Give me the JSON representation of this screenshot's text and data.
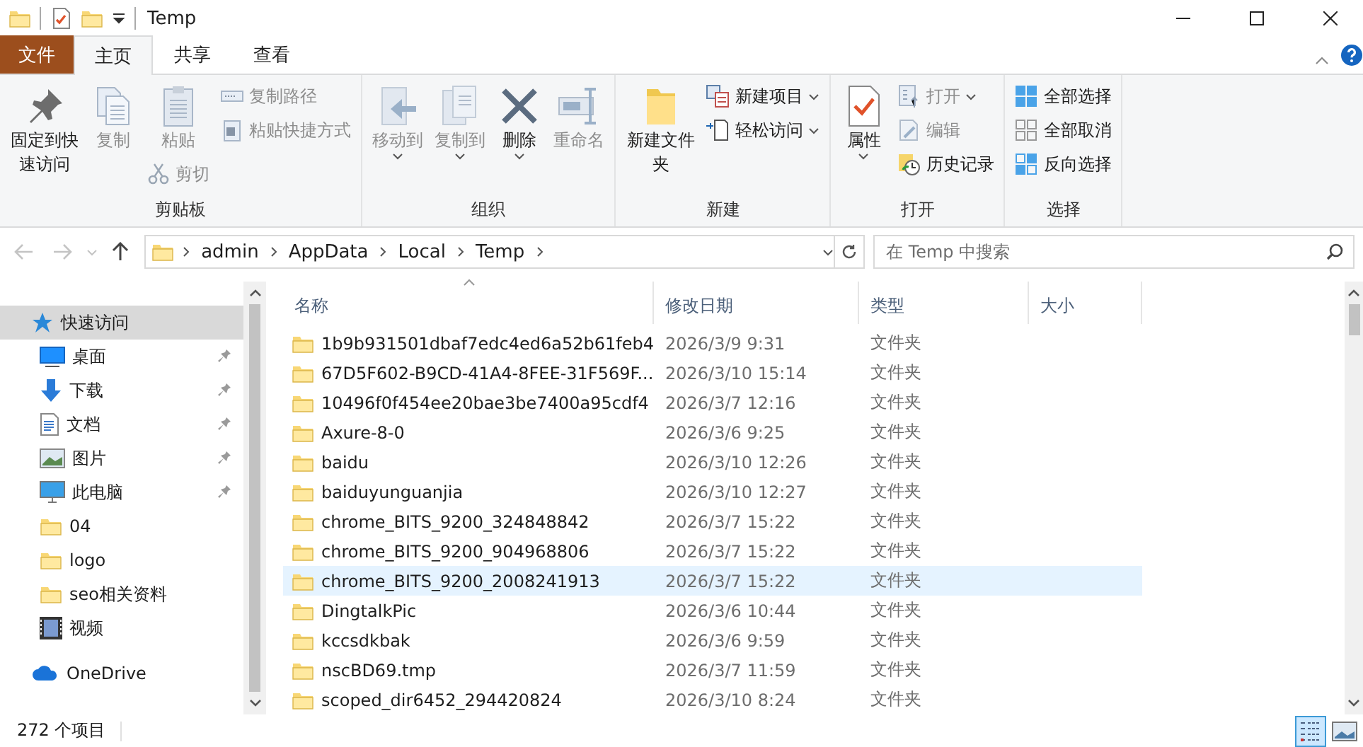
{
  "window": {
    "title": "Temp"
  },
  "ribbon_tabs": [
    {
      "label": "文件",
      "kind": "file",
      "selected": false
    },
    {
      "label": "主页",
      "kind": "tab",
      "selected": true
    },
    {
      "label": "共享",
      "kind": "tab",
      "selected": false
    },
    {
      "label": "查看",
      "kind": "tab",
      "selected": false
    }
  ],
  "ribbon_groups": [
    {
      "label": "剪贴板",
      "columns": [
        [
          {
            "label": "固定到快速访问",
            "kind": "large",
            "disabled": false,
            "menu": false
          }
        ],
        [
          {
            "label": "复制",
            "kind": "large",
            "disabled": true,
            "menu": false
          }
        ],
        [
          {
            "label": "粘贴",
            "kind": "large",
            "disabled": true,
            "menu": false
          },
          {
            "label": "剪切",
            "kind": "small",
            "disabled": true,
            "menu": false
          }
        ],
        [
          {
            "label": "复制路径",
            "kind": "small",
            "disabled": true,
            "menu": false
          },
          {
            "label": "粘贴快捷方式",
            "kind": "small",
            "disabled": true,
            "menu": false
          }
        ]
      ]
    },
    {
      "label": "组织",
      "columns": [
        [
          {
            "label": "移动到",
            "kind": "large",
            "disabled": true,
            "menu": true
          }
        ],
        [
          {
            "label": "复制到",
            "kind": "large",
            "disabled": true,
            "menu": true
          }
        ],
        [
          {
            "label": "删除",
            "kind": "large",
            "disabled": false,
            "menu": true
          }
        ],
        [
          {
            "label": "重命名",
            "kind": "large",
            "disabled": true,
            "menu": false
          }
        ]
      ]
    },
    {
      "label": "新建",
      "columns": [
        [
          {
            "label": "新建文件夹",
            "kind": "large",
            "disabled": false,
            "menu": false
          }
        ],
        [
          {
            "label": "新建项目",
            "kind": "small",
            "disabled": false,
            "menu": true
          },
          {
            "label": "轻松访问",
            "kind": "small",
            "disabled": false,
            "menu": true
          }
        ]
      ]
    },
    {
      "label": "打开",
      "columns": [
        [
          {
            "label": "属性",
            "kind": "large",
            "disabled": false,
            "menu": true
          }
        ],
        [
          {
            "label": "打开",
            "kind": "small",
            "disabled": true,
            "menu": true
          },
          {
            "label": "编辑",
            "kind": "small",
            "disabled": true,
            "menu": false
          },
          {
            "label": "历史记录",
            "kind": "small",
            "disabled": false,
            "menu": false
          }
        ]
      ]
    },
    {
      "label": "选择",
      "columns": [
        [
          {
            "label": "全部选择",
            "kind": "small",
            "disabled": false,
            "menu": false
          },
          {
            "label": "全部取消",
            "kind": "small",
            "disabled": false,
            "menu": false
          },
          {
            "label": "反向选择",
            "kind": "small",
            "disabled": false,
            "menu": false
          }
        ]
      ]
    }
  ],
  "address_bar": {
    "path": [
      "admin",
      "AppData",
      "Local",
      "Temp"
    ]
  },
  "search": {
    "placeholder": "在 Temp 中搜索"
  },
  "sidebar": {
    "items": [
      {
        "label": "快速访问",
        "selected": true,
        "pinned": false,
        "children": [
          {
            "label": "桌面",
            "selected": false,
            "pinned": true
          },
          {
            "label": "下载",
            "selected": false,
            "pinned": true
          },
          {
            "label": "文档",
            "selected": false,
            "pinned": true
          },
          {
            "label": "图片",
            "selected": false,
            "pinned": true
          },
          {
            "label": "此电脑",
            "selected": false,
            "pinned": true
          },
          {
            "label": "04",
            "selected": false,
            "pinned": false
          },
          {
            "label": "logo",
            "selected": false,
            "pinned": false
          },
          {
            "label": "seo相关资料",
            "selected": false,
            "pinned": false
          },
          {
            "label": "视频",
            "selected": false,
            "pinned": false
          }
        ]
      },
      {
        "label": "OneDrive",
        "selected": false,
        "pinned": false
      }
    ]
  },
  "table": {
    "columns": [
      "名称",
      "修改日期",
      "类型",
      "大小"
    ],
    "rows": [
      {
        "name": "1b9b931501dbaf7edc4ed6a52b61feb4",
        "modified": "2026/3/9 9:31",
        "type": "文件夹",
        "highlighted": false
      },
      {
        "name": "67D5F602-B9CD-41A4-8FEE-31F569F...",
        "modified": "2026/3/10 15:14",
        "type": "文件夹",
        "highlighted": false
      },
      {
        "name": "10496f0f454ee20bae3be7400a95cdf4",
        "modified": "2026/3/7 12:16",
        "type": "文件夹",
        "highlighted": false
      },
      {
        "name": "Axure-8-0",
        "modified": "2026/3/6 9:25",
        "type": "文件夹",
        "highlighted": false
      },
      {
        "name": "baidu",
        "modified": "2026/3/10 12:26",
        "type": "文件夹",
        "highlighted": false
      },
      {
        "name": "baiduyunguanjia",
        "modified": "2026/3/10 12:27",
        "type": "文件夹",
        "highlighted": false
      },
      {
        "name": "chrome_BITS_9200_324848842",
        "modified": "2026/3/7 15:22",
        "type": "文件夹",
        "highlighted": false
      },
      {
        "name": "chrome_BITS_9200_904968806",
        "modified": "2026/3/7 15:22",
        "type": "文件夹",
        "highlighted": false
      },
      {
        "name": "chrome_BITS_9200_2008241913",
        "modified": "2026/3/7 15:22",
        "type": "文件夹",
        "highlighted": true
      },
      {
        "name": "DingtalkPic",
        "modified": "2026/3/6 10:44",
        "type": "文件夹",
        "highlighted": false
      },
      {
        "name": "kccsdkbak",
        "modified": "2026/3/6 9:59",
        "type": "文件夹",
        "highlighted": false
      },
      {
        "name": "nscBD69.tmp",
        "modified": "2026/3/7 11:59",
        "type": "文件夹",
        "highlighted": false
      },
      {
        "name": "scoped_dir6452_294420824",
        "modified": "2026/3/10 8:24",
        "type": "文件夹",
        "highlighted": false
      }
    ]
  },
  "status_bar": {
    "item_count": "272 个项目"
  },
  "view_buttons": [
    {
      "kind": "details",
      "selected": true
    },
    {
      "kind": "thumbnails",
      "selected": false
    }
  ]
}
